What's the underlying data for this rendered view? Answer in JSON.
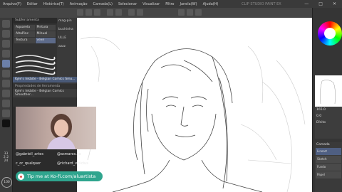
{
  "menu": {
    "items": [
      "Arquivo(F)",
      "Editar",
      "Histórico(T)",
      "Animação",
      "Camada(L)",
      "Selecionar",
      "Visualizar",
      "Filtro",
      "Janela(W)",
      "Ajuda(H)"
    ],
    "title": "CLIP STUDIO PAINT EX"
  },
  "subtool": {
    "header": "Subferramenta",
    "brushes": [
      "Aquarela",
      "Pintura",
      "AltaPinc",
      "Mihual",
      "Textura",
      "vexe"
    ],
    "list": [
      "buchinha",
      "ULLE",
      "azzz",
      "mag-pin"
    ]
  },
  "brush_name": "Kyle's Inkbite - Belgian Comics Smo...",
  "tool_property": {
    "header": "Propriedades de ferramenta",
    "name": "Kyle's Inkbite - Belgian Comics Smoother..."
  },
  "overlay": {
    "handles": [
      {
        "name": "@gabriell_artes"
      },
      {
        "name": "@asmaros.ca"
      },
      {
        "name": "c_or_qualquer"
      },
      {
        "name": "@richard_vinicius"
      }
    ],
    "kofi": "Tip me at Ko-fi.com/aluartista"
  },
  "left_numbers": [
    "33",
    "2.2",
    "24"
  ],
  "zoom_label": "100",
  "right_panel": {
    "values": [
      "165.0",
      "0.0"
    ],
    "labels": [
      "Efeito",
      "Camada"
    ],
    "layers": [
      "Lineart",
      "Sketch",
      "Fundo",
      "Papel"
    ]
  },
  "colors": {
    "accent": "#5d6b8a",
    "kofi": "#2fa58e"
  }
}
